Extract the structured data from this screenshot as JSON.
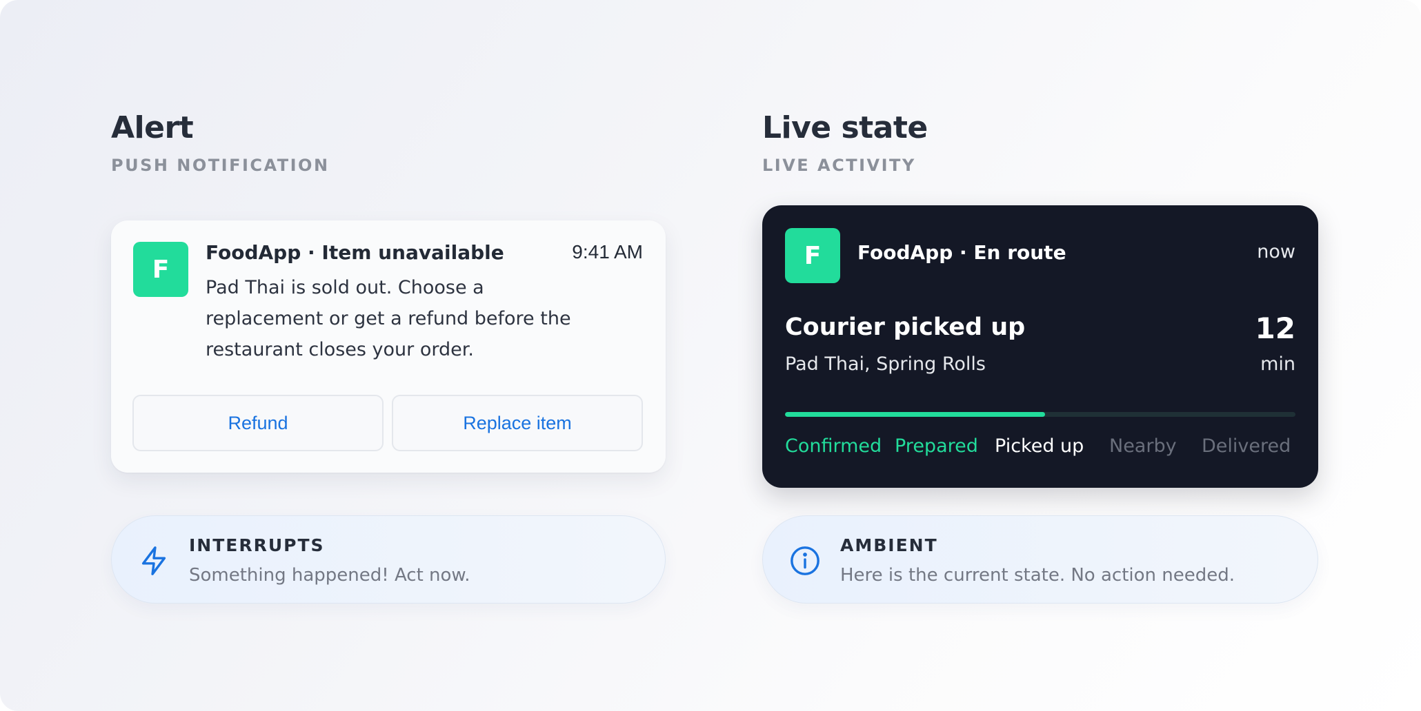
{
  "alert": {
    "title": "Alert",
    "subtitle": "PUSH NOTIFICATION",
    "notification": {
      "app_icon_letter": "F",
      "heading": "FoodApp · Item unavailable",
      "time": "9:41 AM",
      "body": "Pad Thai is sold out. Choose a replacement or get a refund before the restaurant closes your order.",
      "actions": {
        "refund": "Refund",
        "replace": "Replace item"
      }
    },
    "pill": {
      "icon": "lightning-icon",
      "label": "INTERRUPTS",
      "description": "Something happened! Act now."
    }
  },
  "live": {
    "title": "Live state",
    "subtitle": "LIVE ACTIVITY",
    "activity": {
      "app_icon_letter": "F",
      "heading": "FoodApp · En route",
      "time": "now",
      "status": "Courier picked up",
      "items": "Pad Thai, Spring Rolls",
      "eta_value": "12",
      "eta_unit": "min",
      "progress_fraction": 0.51,
      "steps": [
        "Confirmed",
        "Prepared",
        "Picked up",
        "Nearby",
        "Delivered"
      ],
      "current_step_index": 2
    },
    "pill": {
      "icon": "info-icon",
      "label": "AMBIENT",
      "description": "Here is the current state. No action needed."
    }
  },
  "colors": {
    "brand_green": "#22dc9b",
    "action_blue": "#1a73e0",
    "dark_card": "#141826",
    "icon_blue": "#1a73e0"
  }
}
